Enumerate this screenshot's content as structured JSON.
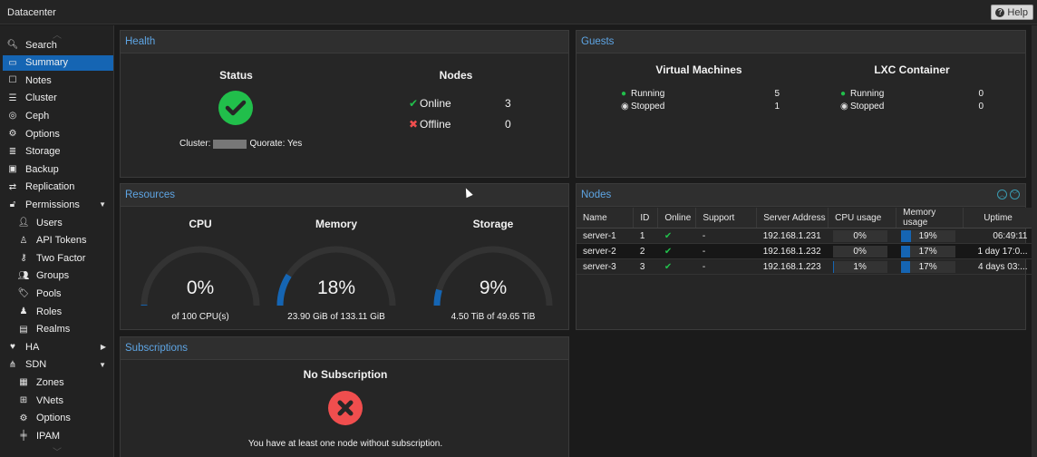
{
  "topbar": {
    "title": "Datacenter",
    "help_label": "Help"
  },
  "sidebar": {
    "items": [
      {
        "label": "Search",
        "icon": "search-icon",
        "glyph": "🔍︎"
      },
      {
        "label": "Summary",
        "icon": "book-icon",
        "glyph": "▭",
        "active": true
      },
      {
        "label": "Notes",
        "icon": "note-icon",
        "glyph": "☐"
      },
      {
        "label": "Cluster",
        "icon": "server-icon",
        "glyph": "☰"
      },
      {
        "label": "Ceph",
        "icon": "ceph-icon",
        "glyph": "◎"
      },
      {
        "label": "Options",
        "icon": "gear-icon",
        "glyph": "⚙"
      },
      {
        "label": "Storage",
        "icon": "database-icon",
        "glyph": "≣"
      },
      {
        "label": "Backup",
        "icon": "floppy-icon",
        "glyph": "▣"
      },
      {
        "label": "Replication",
        "icon": "retweet-icon",
        "glyph": "⇄"
      },
      {
        "label": "Permissions",
        "icon": "unlock-icon",
        "glyph": "🔓︎",
        "expanded": true
      },
      {
        "label": "Users",
        "icon": "user-icon",
        "glyph": "👤︎",
        "sub": true
      },
      {
        "label": "API Tokens",
        "icon": "user-outline-icon",
        "glyph": "♙",
        "sub": true
      },
      {
        "label": "Two Factor",
        "icon": "key-icon",
        "glyph": "⚷",
        "sub": true
      },
      {
        "label": "Groups",
        "icon": "users-icon",
        "glyph": "👥︎",
        "sub": true
      },
      {
        "label": "Pools",
        "icon": "tags-icon",
        "glyph": "🏷︎",
        "sub": true
      },
      {
        "label": "Roles",
        "icon": "male-icon",
        "glyph": "♟",
        "sub": true
      },
      {
        "label": "Realms",
        "icon": "address-book-icon",
        "glyph": "▤",
        "sub": true
      },
      {
        "label": "HA",
        "icon": "heartbeat-icon",
        "glyph": "♥",
        "collapsed": true
      },
      {
        "label": "SDN",
        "icon": "network-icon",
        "glyph": "⋔",
        "expanded": true
      },
      {
        "label": "Zones",
        "icon": "grid-icon",
        "glyph": "▦",
        "sub": true
      },
      {
        "label": "VNets",
        "icon": "sitemap-icon",
        "glyph": "⊞",
        "sub": true
      },
      {
        "label": "Options",
        "icon": "gear-icon",
        "glyph": "⚙",
        "sub": true
      },
      {
        "label": "IPAM",
        "icon": "ipam-icon",
        "glyph": "╪",
        "sub": true
      }
    ]
  },
  "health": {
    "title": "Health",
    "status_heading": "Status",
    "cluster_label": "Cluster:",
    "quorate_label": "Quorate: Yes",
    "nodes_heading": "Nodes",
    "online_label": "Online",
    "online_count": "3",
    "offline_label": "Offline",
    "offline_count": "0",
    "status_color": "#21bf4b"
  },
  "guests": {
    "title": "Guests",
    "vm": {
      "heading": "Virtual Machines",
      "running_label": "Running",
      "running": "5",
      "stopped_label": "Stopped",
      "stopped": "1"
    },
    "lxc": {
      "heading": "LXC Container",
      "running_label": "Running",
      "running": "0",
      "stopped_label": "Stopped",
      "stopped": "0"
    }
  },
  "resources": {
    "title": "Resources",
    "gauges": [
      {
        "label": "CPU",
        "value": "0%",
        "fraction": 0.005,
        "sub": "of 100 CPU(s)"
      },
      {
        "label": "Memory",
        "value": "18%",
        "fraction": 0.18,
        "sub": "23.90 GiB of 133.11 GiB"
      },
      {
        "label": "Storage",
        "value": "9%",
        "fraction": 0.09,
        "sub": "4.50 TiB of 49.65 TiB"
      }
    ],
    "accent": "#1565b3"
  },
  "nodes": {
    "title": "Nodes",
    "columns": [
      "Name",
      "ID",
      "Online",
      "Support",
      "Server Address",
      "CPU usage",
      "Memory usage",
      "Uptime"
    ],
    "rows": [
      {
        "name": "server-1",
        "id": "1",
        "online": "✔",
        "support": "-",
        "address": "192.168.1.231",
        "cpu": "0%",
        "cpu_frac": 0.0,
        "mem": "19%",
        "mem_frac": 0.19,
        "uptime": "06:49:11"
      },
      {
        "name": "server-2",
        "id": "2",
        "online": "✔",
        "support": "-",
        "address": "192.168.1.232",
        "cpu": "0%",
        "cpu_frac": 0.0,
        "mem": "17%",
        "mem_frac": 0.17,
        "uptime": "1 day 17:0..."
      },
      {
        "name": "server-3",
        "id": "3",
        "online": "✔",
        "support": "-",
        "address": "192.168.1.223",
        "cpu": "1%",
        "cpu_frac": 0.01,
        "mem": "17%",
        "mem_frac": 0.17,
        "uptime": "4 days 03:..."
      }
    ]
  },
  "subscriptions": {
    "title": "Subscriptions",
    "heading": "No Subscription",
    "message": "You have at least one node without subscription.",
    "error_color": "#f04e4e"
  }
}
